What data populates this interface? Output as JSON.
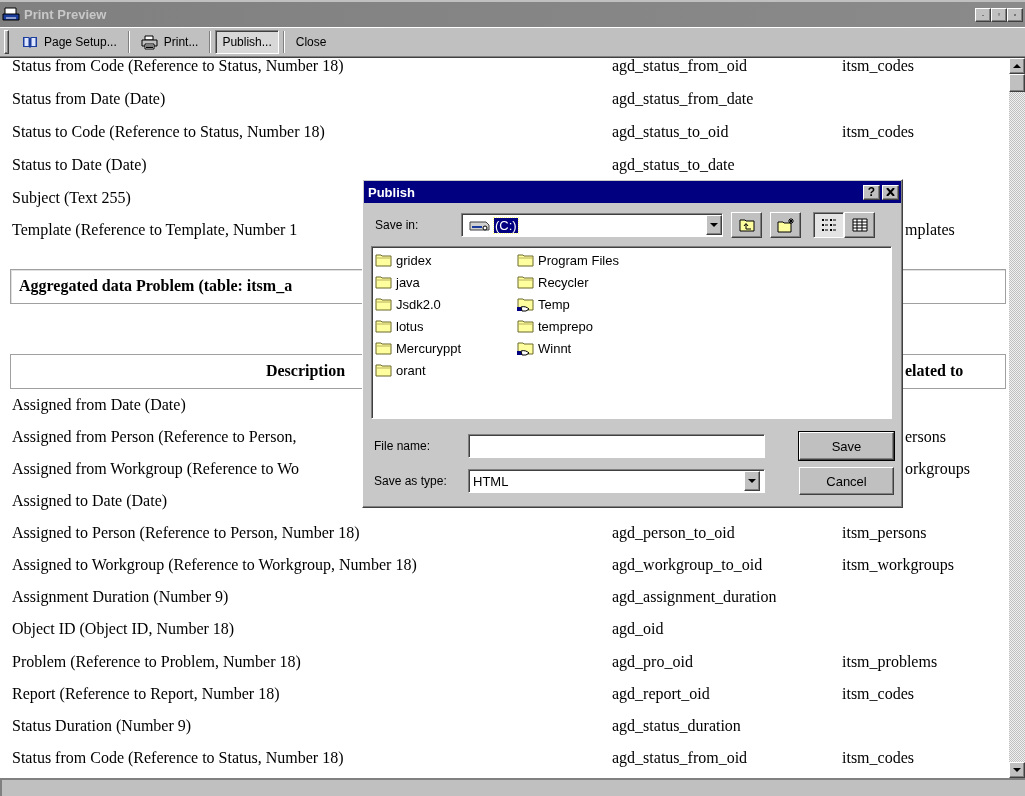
{
  "window": {
    "title": "Print Preview"
  },
  "toolbar": [
    {
      "kind": "page-setup",
      "label": "Page Setup...",
      "pressed": false
    },
    {
      "kind": "print",
      "label": "Print...",
      "pressed": false
    },
    {
      "kind": "plain",
      "label": "Publish...",
      "pressed": true
    },
    {
      "kind": "plain",
      "label": "Close",
      "pressed": false
    }
  ],
  "document": {
    "top_rows": [
      {
        "kind": "full",
        "description": "Status from Code (Reference to Status, Number 18)",
        "name": "agd_status_from_oid",
        "related": "itsm_codes"
      },
      {
        "kind": "full",
        "description": "Status from Date (Date)",
        "name": "agd_status_from_date"
      },
      {
        "kind": "full",
        "description": "Status to Code (Reference to Status, Number 18)",
        "name": "agd_status_to_oid",
        "related": "itsm_codes"
      },
      {
        "kind": "full",
        "description": "Status to Date (Date)",
        "name": "agd_status_to_date"
      },
      {
        "kind": "covered",
        "description": "Subject (Text 255)"
      },
      {
        "kind": "covered",
        "description": "Template (Reference to Template, Number 1",
        "related": "mplates"
      }
    ],
    "section_title": "Aggregated data Problem (table: itsm_a",
    "header": {
      "description": "Description",
      "related": "elated to"
    },
    "rows": [
      {
        "kind": "covered",
        "description": "Assigned from Date (Date)"
      },
      {
        "kind": "covered",
        "description": "Assigned from Person (Reference to Person,",
        "related": "ersons"
      },
      {
        "kind": "covered",
        "description": "Assigned from Workgroup (Reference to Wo",
        "related": "orkgroups"
      },
      {
        "kind": "covered",
        "description": "Assigned to Date (Date)"
      },
      {
        "kind": "full",
        "description": "Assigned to Person (Reference to Person, Number 18)",
        "name": "agd_person_to_oid",
        "related": "itsm_persons"
      },
      {
        "kind": "full",
        "description": "Assigned to Workgroup (Reference to Workgroup, Number 18)",
        "name": "agd_workgroup_to_oid",
        "related": "itsm_workgroups"
      },
      {
        "kind": "full",
        "description": "Assignment Duration (Number 9)",
        "name": "agd_assignment_duration"
      },
      {
        "kind": "full",
        "description": "Object ID (Object ID, Number 18)",
        "name": "agd_oid"
      },
      {
        "kind": "full",
        "description": "Problem (Reference to Problem, Number 18)",
        "name": "agd_pro_oid",
        "related": "itsm_problems"
      },
      {
        "kind": "full",
        "description": "Report (Reference to Report, Number 18)",
        "name": "agd_report_oid",
        "related": "itsm_codes"
      },
      {
        "kind": "full",
        "description": "Status Duration (Number 9)",
        "name": "agd_status_duration"
      },
      {
        "kind": "full",
        "description": "Status from Code (Reference to Status, Number 18)",
        "name": "agd_status_from_oid",
        "related": "itsm_codes"
      }
    ]
  },
  "dialog": {
    "title": "Publish",
    "help": "?",
    "save_in": {
      "label": "Save in:",
      "value": "(C:)"
    },
    "views": [
      {
        "kind": "list",
        "selected": true
      },
      {
        "kind": "details",
        "selected": false
      }
    ],
    "folders": [
      {
        "name": "gridex",
        "kind": "folder"
      },
      {
        "name": "java",
        "kind": "folder"
      },
      {
        "name": "Jsdk2.0",
        "kind": "folder"
      },
      {
        "name": "lotus",
        "kind": "folder"
      },
      {
        "name": "Mercuryppt",
        "kind": "folder"
      },
      {
        "name": "orant",
        "kind": "folder"
      },
      {
        "name": "Program Files",
        "kind": "folder"
      },
      {
        "name": "Recycler",
        "kind": "folder"
      },
      {
        "name": "Temp",
        "kind": "shared"
      },
      {
        "name": "temprepo",
        "kind": "folder"
      },
      {
        "name": "Winnt",
        "kind": "shared"
      }
    ],
    "file_name": {
      "label": "File name:"
    },
    "file_type": {
      "label": "Save as type:",
      "value": "HTML"
    },
    "buttons": [
      {
        "kind": "default",
        "label": "Save"
      },
      {
        "kind": "normal",
        "label": "Cancel"
      }
    ]
  }
}
